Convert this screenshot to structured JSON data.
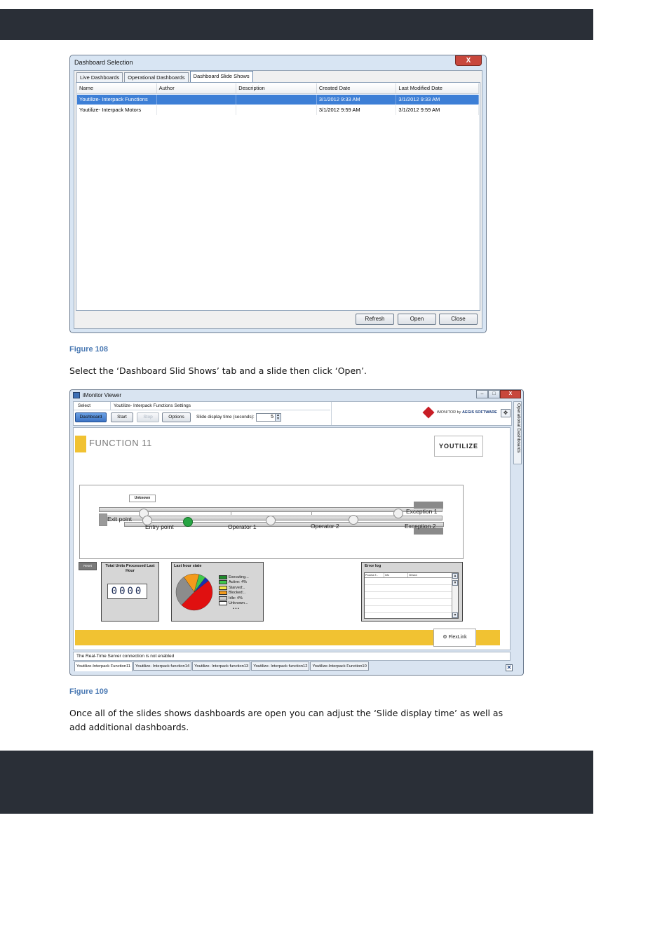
{
  "figure1": {
    "caption": "Figure 108",
    "dialog": {
      "title": "Dashboard Selection",
      "close_glyph": "X",
      "tabs": [
        {
          "label": "Live Dashboards",
          "active": false
        },
        {
          "label": "Operational Dashboards",
          "active": false
        },
        {
          "label": "Dashboard Slide Shows",
          "active": true
        }
      ],
      "columns": [
        "Name",
        "Author",
        "Description",
        "Created Date",
        "Last Modified Date"
      ],
      "rows": [
        {
          "name": "Youtilize- Interpack Functions",
          "author": "",
          "description": "",
          "created": "3/1/2012 9:33 AM",
          "modified": "3/1/2012 9:33 AM",
          "selected": true
        },
        {
          "name": "Youtilize- Interpack Motors",
          "author": "",
          "description": "",
          "created": "3/1/2012 9:59 AM",
          "modified": "3/1/2012 9:59 AM",
          "selected": false
        }
      ],
      "buttons": {
        "refresh": "Refresh",
        "open": "Open",
        "close": "Close"
      }
    }
  },
  "paragraph1": "Select the ‘Dashboard Slid Shows’ tab and a slide then click ‘Open’.",
  "figure2": {
    "caption": "Figure 109",
    "window": {
      "title": "iMonitor Viewer",
      "controls": {
        "minimize": "–",
        "maximize": "□",
        "close": "X"
      },
      "toolbar": {
        "select_label": "Select",
        "settings_label": "Youtilize- Interpack Functions Settings",
        "dashboard_btn": "Dashboard",
        "start_btn": "Start",
        "stop_btn": "Stop",
        "options_btn": "Options",
        "slide_time_label": "Slide display time (seconds):",
        "slide_time_value": "5",
        "brand_prefix": "iMONITOR by ",
        "brand_name": "AEGIS SOFTWARE"
      },
      "side_tab": "Operational Dashboards",
      "dashboard": {
        "title": "FUNCTION 11",
        "logo_text": "YOUTILIZE",
        "line": {
          "unknown_label": "Unknown",
          "exit_point": "Exit  point",
          "entry_point": "Entry  point",
          "operator1": "Operator 1",
          "operator2": "Operator 2",
          "exception1": "Exception 1",
          "exception2": "Exception 2"
        },
        "small_button": "Reset",
        "units_panel": {
          "title": "Total Units Processed Last Hour",
          "value": "0000"
        },
        "state_panel": {
          "title": "Last hour state",
          "legend": [
            {
              "label": "Executing...",
              "color": "#1f8a2c"
            },
            {
              "label": "Active: 4%",
              "color": "#3fc84b"
            },
            {
              "label": "Starved:..",
              "color": "#f2e84a"
            },
            {
              "label": "Blocked:..",
              "color": "#f39a1c"
            },
            {
              "label": "Idle: 4%",
              "color": "#c9c9c9"
            },
            {
              "label": "Unknown...",
              "color": "#ffffff"
            }
          ],
          "more": "• • •",
          "chart_data": {
            "type": "pie",
            "labels": [
              "Red",
              "Grey",
              "Orange",
              "Green",
              "Blue"
            ],
            "values": [
              48,
              28,
              14,
              6,
              4
            ],
            "colors": [
              "#e01010",
              "#8c8c8c",
              "#f39a1c",
              "#3fc84b",
              "#1a2fb0"
            ]
          }
        },
        "error_panel": {
          "title": "Error log",
          "columns": [
            "Process T...",
            "Info",
            "Version"
          ]
        },
        "footer_logo": "FlexLink"
      },
      "status": "The Real-Time Server connection is not enabled",
      "bottom_tabs": [
        {
          "label": "Youtilize-Interpack Function11",
          "active": true
        },
        {
          "label": "Youtilize- Interpack function14",
          "active": false
        },
        {
          "label": "Youtilize- Interpack function13",
          "active": false
        },
        {
          "label": "Youtilize- Interpack function12",
          "active": false
        },
        {
          "label": "Youtilize-Interpack Function10",
          "active": false
        }
      ],
      "close_tab_glyph": "✕"
    }
  },
  "paragraph2": "Once all of the slides shows dashboards are open you can adjust the ‘Slide display time’ as well as add additional dashboards."
}
